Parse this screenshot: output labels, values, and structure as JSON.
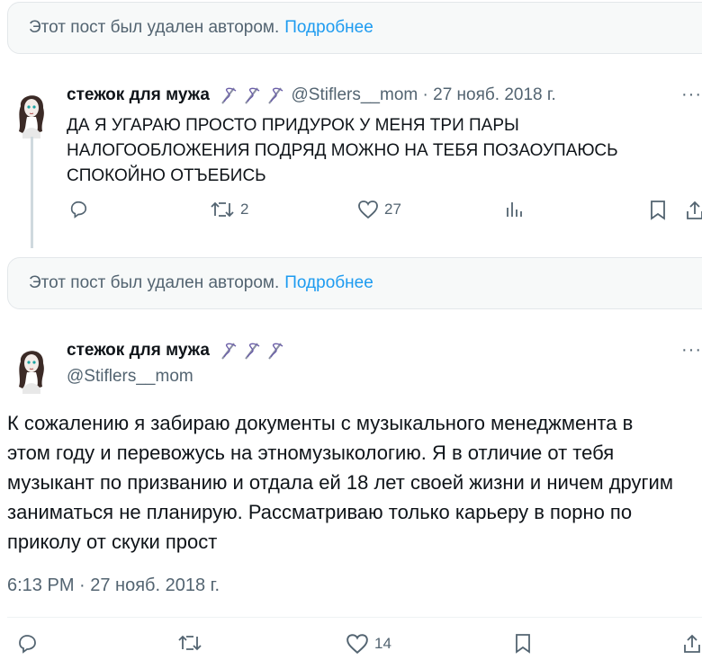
{
  "deleted_notice": {
    "text": "Этот пост был удален автором.",
    "link": "Подробнее"
  },
  "reply": {
    "author_name": "стежок для мужа",
    "emoji": [
      "needle-thread-icon",
      "needle-thread-icon",
      "needle-thread-icon"
    ],
    "handle": "@Stiflers__mom",
    "date": "· 27 нояб. 2018 г.",
    "text": "ДА Я УГАРАЮ ПРОСТО ПРИДУРОК У МЕНЯ ТРИ ПАРЫ НАЛОГООБЛОЖЕНИЯ ПОДРЯД МОЖНО НА ТЕБЯ ПОЗАОУПАЮСЬ СПОКОЙНО ОТЪЕБИСЬ",
    "retweets": "2",
    "likes": "27"
  },
  "main_tweet": {
    "author_name": "стежок для мужа",
    "handle": "@Stiflers__mom",
    "text": "К сожалению я забираю документы с музыкального менеджмента в этом году и перевожусь на этномузыкологию. Я в отличие от тебя музыкант по призванию и отдала ей 18 лет своей жизни и ничем другим заниматься не планирую. Рассматриваю только карьеру в порно по приколу от скуки прост",
    "timestamp": "6:13 PM · 27 нояб. 2018 г.",
    "likes": "14"
  },
  "more_label": "···",
  "colors": {
    "accent": "#1d9bf0",
    "muted": "#536471",
    "text": "#0f1419",
    "emoji": "#6b5fa8"
  }
}
